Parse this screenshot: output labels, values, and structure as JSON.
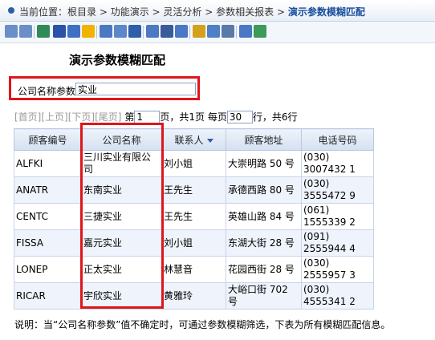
{
  "breadcrumb": {
    "prefix": "当前位置：",
    "items": [
      "根目录",
      "功能演示",
      "灵活分析",
      "参数相关报表"
    ],
    "separator": " > ",
    "current": "演示参数模糊匹配"
  },
  "toolbar": {
    "icons": [
      "back-icon",
      "forward-icon",
      "refresh-icon",
      "save-icon",
      "save-as-icon",
      "favorite-icon",
      "print-preview-icon",
      "export-icon",
      "page-setup-icon",
      "query-icon",
      "sum-icon",
      "param-icon",
      "chart-icon",
      "report-icon",
      "print-icon",
      "layout-icon",
      "settings-icon"
    ],
    "colors": [
      "#6a8fc7",
      "#6a8fc7",
      "#2e8b57",
      "#2a52a8",
      "#3f6fc2",
      "#f0b400",
      "#4a78c2",
      "#5c87c9",
      "#2e5fa8",
      "#4d79c2",
      "#3a5a9a",
      "#4a78c2",
      "#d3a21a",
      "#4f7fc4",
      "#5a7aa8",
      "#4a78c2",
      "#3c9a5a"
    ]
  },
  "page_title": "演示参数模糊匹配",
  "param": {
    "label": "公司名称参数",
    "value": "实业"
  },
  "pager": {
    "first": "[首页]",
    "prev": "[上页]",
    "next": "[下页]",
    "last": "[尾页]",
    "page_prefix": "第",
    "page_value": "1",
    "page_suffix": "页，共1页",
    "size_prefix": "每页",
    "size_value": "30",
    "size_suffix": "行，共6行"
  },
  "table": {
    "headers": [
      "顾客编号",
      "公司名称",
      "联系人",
      "顾客地址",
      "电话号码"
    ],
    "rows": [
      [
        "ALFKI",
        "三川实业有限公司",
        "刘小姐",
        "大崇明路 50 号",
        "(030) 3007432 1"
      ],
      [
        "ANATR",
        "东南实业",
        "王先生",
        "承德西路 80 号",
        "(030) 3555472 9"
      ],
      [
        "CENTC",
        "三捷实业",
        "王先生",
        "英雄山路 84 号",
        "(061) 1555339 2"
      ],
      [
        "FISSA",
        "嘉元实业",
        "刘小姐",
        "东湖大街 28 号",
        "(091) 2555944 4"
      ],
      [
        "LONEP",
        "正太实业",
        "林慧音",
        "花园西街 28 号",
        "(030) 2555957 3"
      ],
      [
        "RICAR",
        "宇欣实业",
        "黄雅玲",
        "大峪口街 702 号",
        "(030) 4555341 2"
      ]
    ]
  },
  "note": "说明：当“公司名称参数”值不确定时，可通过参数模糊筛选，下表为所有模糊匹配信息。"
}
